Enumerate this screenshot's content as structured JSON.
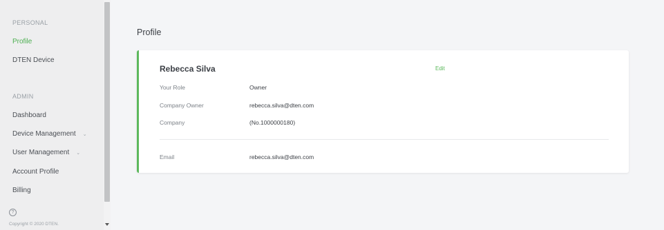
{
  "sidebar": {
    "personal_label": "PERSONAL",
    "personal_items": [
      {
        "label": "Profile",
        "active": true
      },
      {
        "label": "DTEN Device",
        "active": false
      }
    ],
    "admin_label": "ADMIN",
    "admin_items": [
      {
        "label": "Dashboard",
        "expandable": false
      },
      {
        "label": "Device Management",
        "expandable": true
      },
      {
        "label": "User Management",
        "expandable": true
      },
      {
        "label": "Account Profile",
        "expandable": false
      },
      {
        "label": "Billing",
        "expandable": false
      }
    ],
    "help_icon": "help-circle-icon",
    "copyright": "Copyright © 2020 DTEN."
  },
  "main": {
    "title": "Profile",
    "card": {
      "name": "Rebecca Silva",
      "edit_label": "Edit",
      "rows": [
        {
          "label": "Your Role",
          "value": "Owner"
        },
        {
          "label": "Company Owner",
          "value": "rebecca.silva@dten.com"
        },
        {
          "label": "Company",
          "value": "(No.1000000180)"
        }
      ],
      "email": {
        "label": "Email",
        "value": "rebecca.silva@dten.com"
      }
    }
  },
  "colors": {
    "accent": "#5cb85c",
    "sidebar_bg": "#eeeeef",
    "page_bg": "#f4f5f7"
  }
}
